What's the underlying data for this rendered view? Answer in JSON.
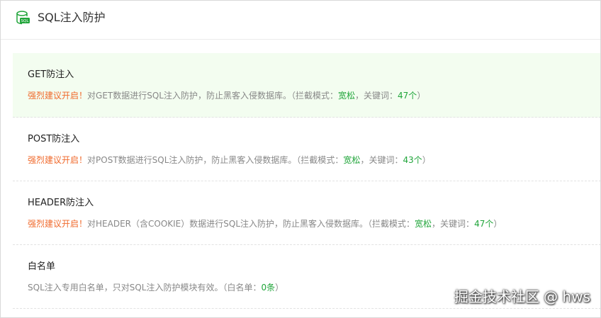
{
  "header": {
    "title": "SQL注入防护",
    "icon": "sql-database-icon",
    "icon_text": "SQL",
    "accent": "#20a53a"
  },
  "colors": {
    "warn": "#f06a2c",
    "green": "#20a53a",
    "active_bg": "#f3fdf0"
  },
  "items": [
    {
      "title": "GET防注入",
      "warn": "强烈建议开启！",
      "desc": "对GET数据进行SQL注入防护，防止黑客入侵数据库。",
      "meta_open": "（拦截模式：",
      "mode": "宽松",
      "kw_label": "，关键词：",
      "kw_count": "47个",
      "meta_close": "）"
    },
    {
      "title": "POST防注入",
      "warn": "强烈建议开启！",
      "desc": "对POST数据进行SQL注入防护，防止黑客入侵数据库。",
      "meta_open": "（拦截模式：",
      "mode": "宽松",
      "kw_label": "，关键词：",
      "kw_count": "43个",
      "meta_close": "）"
    },
    {
      "title": "HEADER防注入",
      "warn": "强烈建议开启！",
      "desc": "对HEADER（含COOKIE）数据进行SQL注入防护，防止黑客入侵数据库。",
      "meta_open": "（拦截模式：",
      "mode": "宽松",
      "kw_label": "，关键词：",
      "kw_count": "47个",
      "meta_close": "）"
    },
    {
      "title": "白名单",
      "desc": "SQL注入专用白名单，只对SQL注入防护模块有效。",
      "meta_open": "（白名单：",
      "count": "0条",
      "meta_close": "）"
    }
  ],
  "watermark": "掘金技术社区 @ hws"
}
